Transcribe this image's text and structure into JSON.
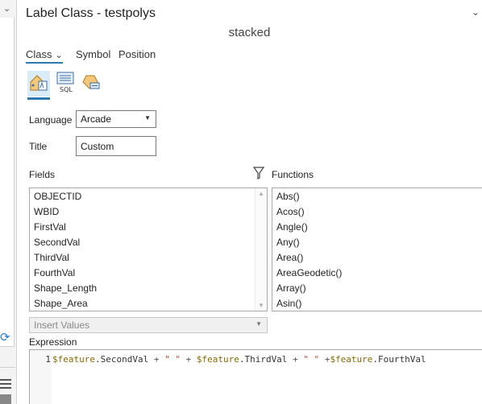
{
  "panel": {
    "title": "Label Class - testpolys",
    "subtitle": "stacked"
  },
  "tabs": [
    {
      "label": "Class",
      "active": true
    },
    {
      "label": "Symbol",
      "active": false
    },
    {
      "label": "Position",
      "active": false
    }
  ],
  "icon_bar": [
    {
      "icon": "label-expression-icon",
      "selected": true
    },
    {
      "icon": "sql-query-icon",
      "sql_text": "SQL",
      "selected": false
    },
    {
      "icon": "label-placement-icon",
      "selected": false
    }
  ],
  "form": {
    "language_label": "Language",
    "language_value": "Arcade",
    "title_label": "Title",
    "title_value": "Custom"
  },
  "fields": {
    "label": "Fields",
    "items": [
      "OBJECTID",
      "WBID",
      "FirstVal",
      "SecondVal",
      "ThirdVal",
      "FourthVal",
      "Shape_Length",
      "Shape_Area"
    ]
  },
  "functions": {
    "label": "Functions",
    "items": [
      "Abs()",
      "Acos()",
      "Angle()",
      "Any()",
      "Area()",
      "AreaGeodetic()",
      "Array()",
      "Asin()"
    ]
  },
  "insert_values": {
    "label": "Insert Values",
    "enabled": false
  },
  "expression": {
    "label": "Expression",
    "line_number": "1",
    "tokens": [
      {
        "t": "$feature",
        "c": "var"
      },
      {
        "t": ".SecondVal ",
        "c": ""
      },
      {
        "t": "+",
        "c": "op"
      },
      {
        "t": " ",
        "c": ""
      },
      {
        "t": "\" \"",
        "c": "str"
      },
      {
        "t": " ",
        "c": ""
      },
      {
        "t": "+",
        "c": "op"
      },
      {
        "t": " ",
        "c": ""
      },
      {
        "t": "$feature",
        "c": "var"
      },
      {
        "t": ".ThirdVal ",
        "c": ""
      },
      {
        "t": "+",
        "c": "op"
      },
      {
        "t": " ",
        "c": ""
      },
      {
        "t": "\" \"",
        "c": "str"
      },
      {
        "t": " ",
        "c": ""
      },
      {
        "t": "+",
        "c": "op"
      },
      {
        "t": "$feature",
        "c": "var"
      },
      {
        "t": ".FourthVal",
        "c": ""
      }
    ]
  },
  "colors": {
    "accent": "#2a7ab0",
    "selected_bg": "#d9ecf8"
  }
}
